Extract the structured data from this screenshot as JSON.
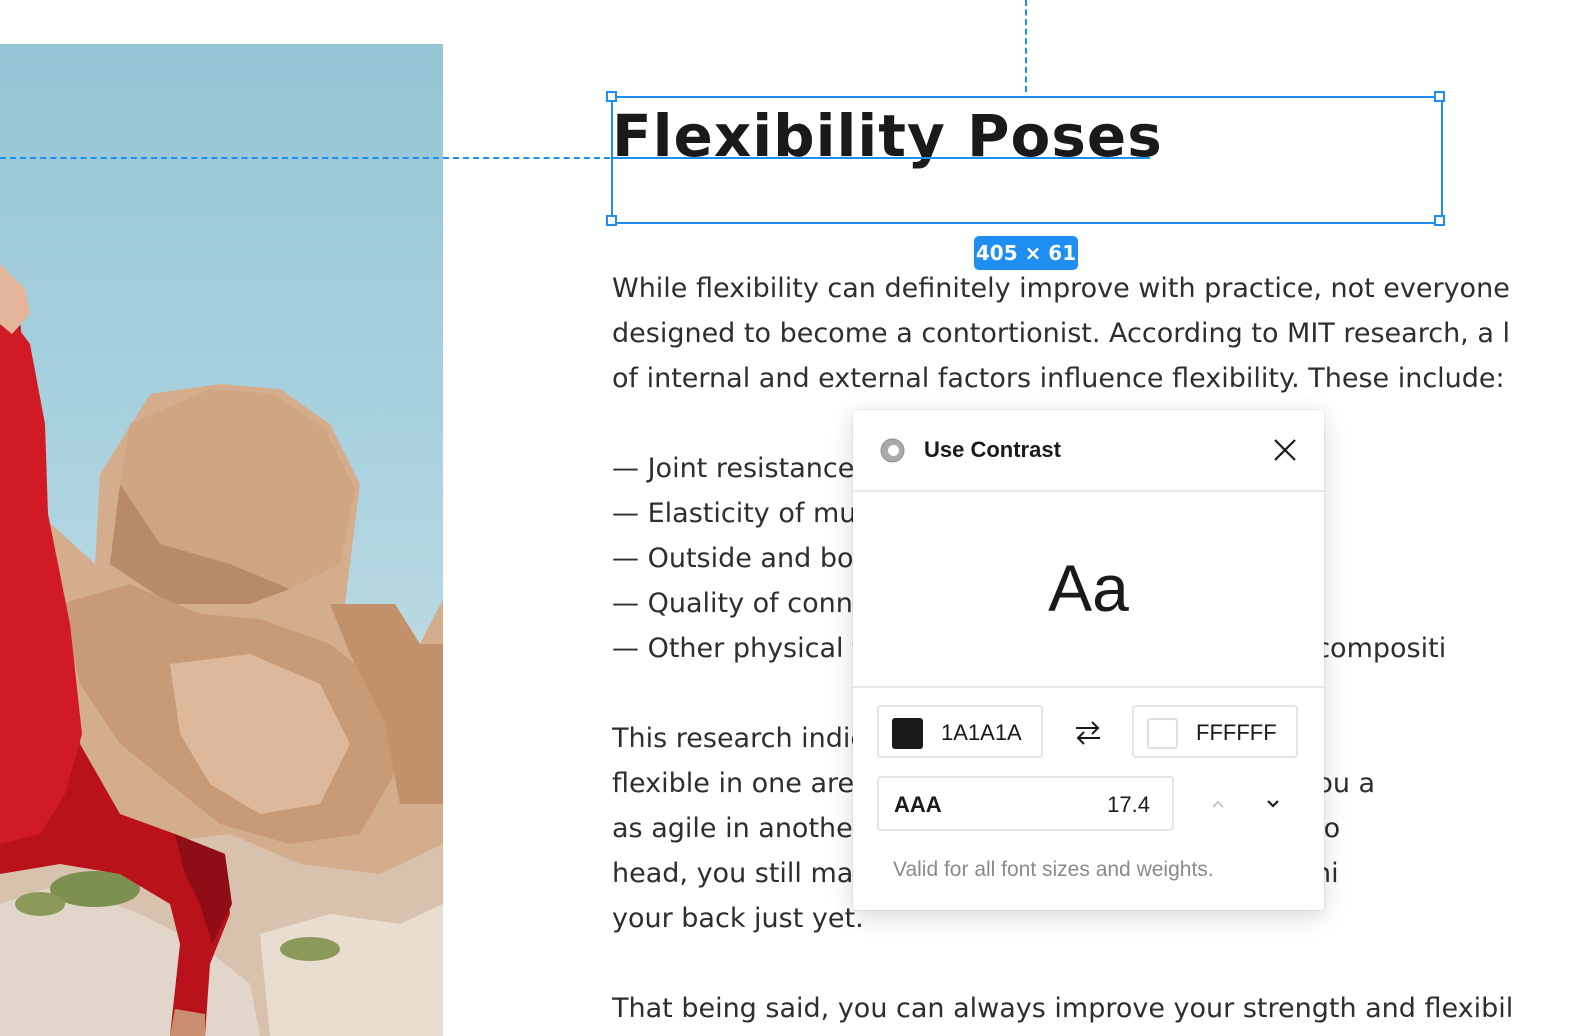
{
  "canvas": {
    "heading": "Flexibility Poses",
    "selection_size_label": "405 × 61",
    "body_lines": [
      "While flexibility can definitely improve with practice, not everyone",
      "designed to become a contortionist. According to MIT research, a l",
      "of internal and external factors influence flexibility. These include:",
      "— Joint resistance",
      "— Elasticity of muscles, ligaments and tendons",
      "— Outside and body temperature",
      "— Quality of connective tissue",
      "— Other physical factors like age, gender and body compositi",
      "This research indicates that if you are innately",
      "flexible in one area, it doesn't automatically mean you a",
      "as agile in another. If you can put your legs behind yo",
      "head, you still may not get your elbows together behi",
      "your back just yet.",
      "That being said, you can always improve your strength and flexibil"
    ]
  },
  "plugin_panel": {
    "title": "Use Contrast",
    "icon": "contrast-circle-icon",
    "preview_text": "Aa",
    "foreground": {
      "hex": "1A1A1A",
      "swatch_color": "#1A1A1A"
    },
    "background": {
      "hex": "FFFFFF",
      "swatch_color": "#FFFFFF"
    },
    "wcag_level": "AAA",
    "contrast_ratio": "17.4",
    "note": "Valid for all font sizes and weights."
  },
  "colors": {
    "accent_blue": "#1E8FF0",
    "text": "#1A1A1A"
  }
}
